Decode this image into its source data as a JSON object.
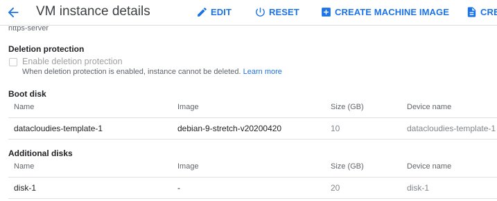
{
  "header": {
    "title": "VM instance details",
    "edit_label": "EDIT",
    "reset_label": "RESET",
    "create_image_label": "CREATE MACHINE IMAGE",
    "create_similar_label": "CREA"
  },
  "clipped_above": "https-server",
  "deletion": {
    "section_title": "Deletion protection",
    "checkbox_label": "Enable deletion protection",
    "checked": false,
    "helper_text": "When deletion protection is enabled, instance cannot be deleted.",
    "learn_more": "Learn more"
  },
  "boot_disk": {
    "section_title": "Boot disk",
    "columns": [
      "Name",
      "Image",
      "Size (GB)",
      "Device name"
    ],
    "rows": [
      {
        "name": "datacloudies-template-1",
        "image": "debian-9-stretch-v20200420",
        "size": "10",
        "device": "datacloudies-template-1"
      }
    ]
  },
  "additional_disks": {
    "section_title": "Additional disks",
    "columns": [
      "Name",
      "Image",
      "Size (GB)",
      "Device name"
    ],
    "rows": [
      {
        "name": "disk-1",
        "image": "-",
        "size": "20",
        "device": "disk-1"
      }
    ]
  },
  "colors": {
    "accent": "#1a73e8",
    "text": "#202124",
    "muted": "#5f6368",
    "divider": "#dadce0"
  },
  "icons": [
    "back-arrow-icon",
    "edit-pencil-icon",
    "reset-power-icon",
    "add-box-icon",
    "document-icon"
  ]
}
